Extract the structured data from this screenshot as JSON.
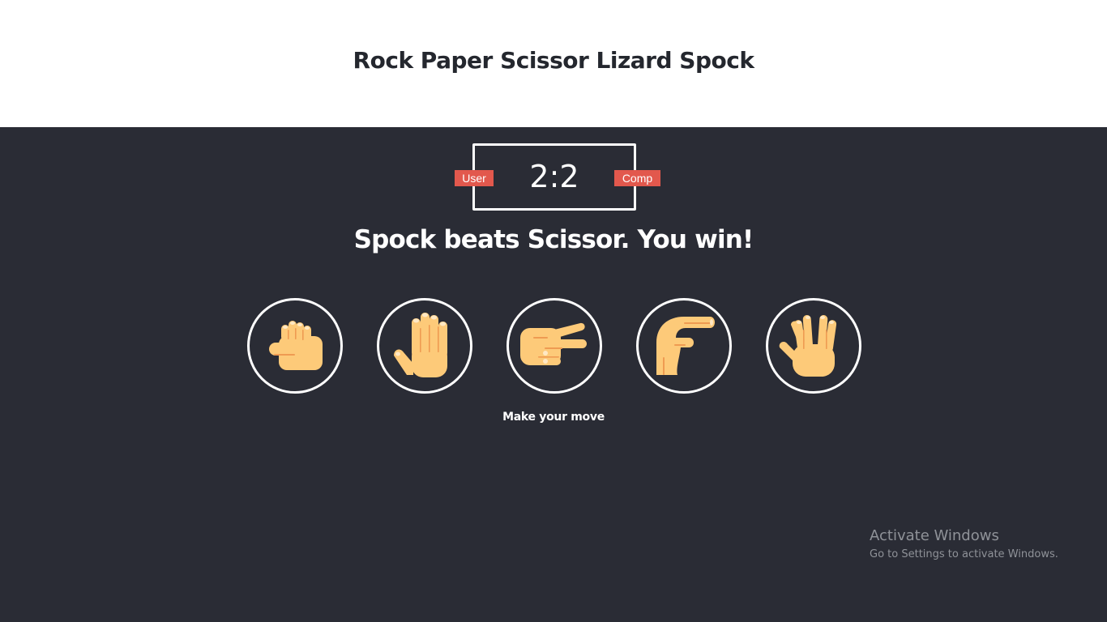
{
  "header": {
    "title": "Rock Paper Scissor Lizard Spock"
  },
  "scoreboard": {
    "user_label": "User",
    "comp_label": "Comp",
    "score": "2:2"
  },
  "result": {
    "message": "Spock beats Scissor. You win!"
  },
  "choices": [
    {
      "name": "rock",
      "icon": "rock-hand-icon"
    },
    {
      "name": "paper",
      "icon": "paper-hand-icon"
    },
    {
      "name": "scissor",
      "icon": "scissor-hand-icon"
    },
    {
      "name": "lizard",
      "icon": "lizard-hand-icon"
    },
    {
      "name": "spock",
      "icon": "spock-hand-icon"
    }
  ],
  "prompt": "Make your move",
  "watermark": {
    "title": "Activate Windows",
    "subtitle": "Go to Settings to activate Windows."
  },
  "colors": {
    "board_bg": "#2a2c35",
    "badge": "#e2584d",
    "skin": "#fdca79",
    "skin_shade": "#ef9b52"
  }
}
